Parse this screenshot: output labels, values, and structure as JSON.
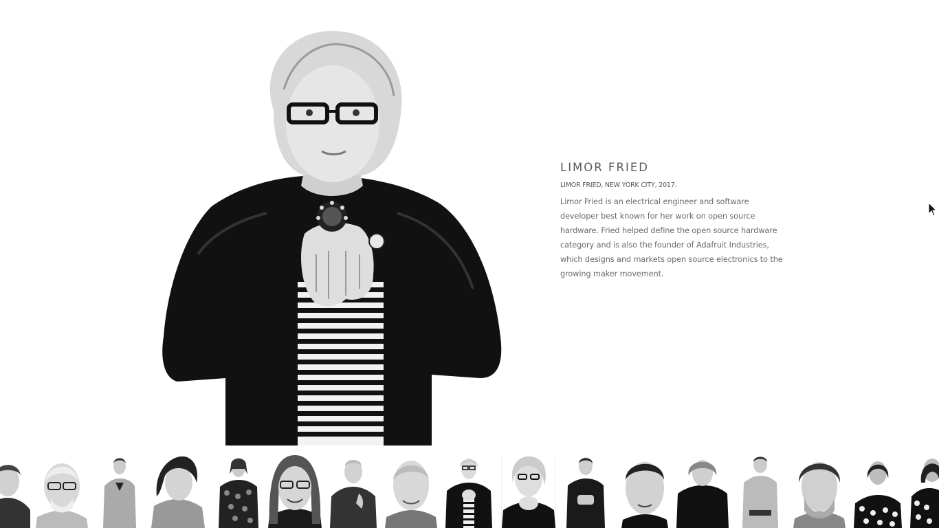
{
  "profile": {
    "name": "LIMOR FRIED",
    "caption": "LIMOR FRIED, NEW YORK CITY, 2017.",
    "description": "Limor Fried is an electrical engineer and software developer best known for her work on open source hardware. Fried helped define the open source hardware category and is also the founder of Adafruit Industries, which designs and markets open source electronics to the growing maker movement.",
    "image_style": "black-and-white portrait"
  },
  "gallery": {
    "thumbnail_count": 17,
    "active_index": 9
  },
  "colors": {
    "background": "#ffffff",
    "text": "#666666",
    "heading": "#5a5a5a"
  }
}
